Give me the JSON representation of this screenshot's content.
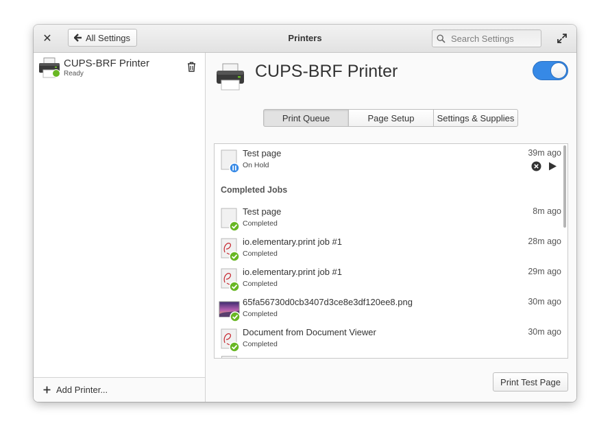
{
  "window": {
    "title": "Printers",
    "back_label": "All Settings",
    "search_placeholder": "Search Settings"
  },
  "sidebar": {
    "printers": [
      {
        "name": "CUPS-BRF Printer",
        "status": "Ready"
      }
    ],
    "add_printer_label": "Add Printer..."
  },
  "main": {
    "printer_title": "CUPS-BRF Printer",
    "enabled": true,
    "tabs": [
      {
        "label": "Print Queue",
        "active": true
      },
      {
        "label": "Page Setup",
        "active": false
      },
      {
        "label": "Settings & Supplies",
        "active": false
      }
    ],
    "active_job": {
      "name": "Test page",
      "status": "On Hold",
      "time": "39m ago",
      "icon": "document-paused"
    },
    "completed_header": "Completed Jobs",
    "completed_jobs": [
      {
        "name": "Test page",
        "status": "Completed",
        "time": "8m ago",
        "icon": "blank-document"
      },
      {
        "name": "io.elementary.print job #1",
        "status": "Completed",
        "time": "28m ago",
        "icon": "red-scribble-document"
      },
      {
        "name": "io.elementary.print job #1",
        "status": "Completed",
        "time": "29m ago",
        "icon": "red-scribble-document"
      },
      {
        "name": "65fa56730d0cb3407d3ce8e3df120ee8.png",
        "status": "Completed",
        "time": "30m ago",
        "icon": "image-thumbnail"
      },
      {
        "name": "Document from Document Viewer",
        "status": "Completed",
        "time": "30m ago",
        "icon": "red-scribble-document"
      }
    ],
    "print_test_label": "Print Test Page"
  },
  "colors": {
    "accent": "#3689e6",
    "success": "#68b723",
    "paused": "#3689e6"
  }
}
